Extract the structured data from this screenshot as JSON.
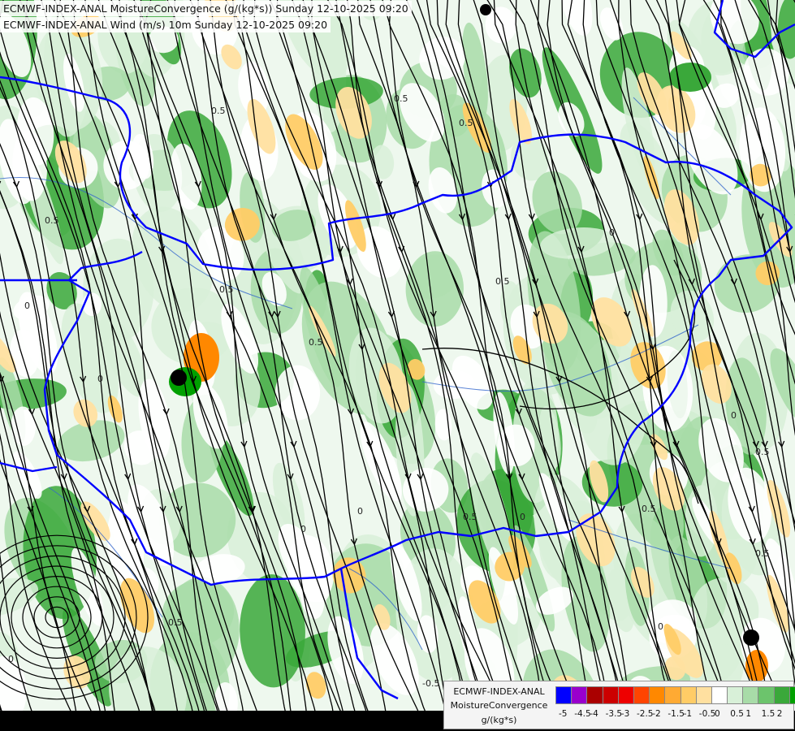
{
  "header": {
    "line1": "ECMWF-INDEX-ANAL MoistureConvergence (g/(kg*s)) Sunday 12-10-2025 09:20",
    "line2": "ECMWF-INDEX-ANAL Wind (m/s) 10m Sunday 12-10-2025 09:20"
  },
  "legend": {
    "model": "ECMWF-INDEX-ANAL",
    "variable": "MoistureConvergence",
    "unit": "g/(kg*s)",
    "ticks": [
      "-5",
      "-4.5",
      "-4",
      "-3.5",
      "-3",
      "-2.5",
      "-2",
      "-1.5",
      "-1",
      "-0.5",
      "0",
      "0.5",
      "1",
      "1.5",
      "2"
    ],
    "colors": [
      "#0000ff",
      "#9900cc",
      "#aa0000",
      "#cc0000",
      "#ee0000",
      "#ff4400",
      "#ff8800",
      "#ffaa33",
      "#ffcc66",
      "#ffe0a0",
      "#ffffff",
      "#d8f0d8",
      "#a8dca8",
      "#6cc46c",
      "#3aa83a",
      "#00a000"
    ]
  },
  "map": {
    "contour_labels": [
      "0",
      "0.5",
      "0",
      "0.5",
      "0",
      "0.5",
      "-0.5",
      "0.5",
      "0",
      "0.5",
      "0",
      "0",
      "0.5",
      "0",
      "0.5",
      "0.5",
      "0.5",
      "0",
      "0.5",
      "0.5",
      "0",
      "0.5"
    ],
    "colors": {
      "border": "#0000ff",
      "streamline": "#000000",
      "river": "#3366cc",
      "green_light": "#d8f0d8",
      "green_mid": "#a8dca8",
      "green_dark": "#3aa83a",
      "orange_light": "#ffe0a0",
      "orange_mid": "#ffcc66",
      "orange_dark": "#ff8800"
    }
  }
}
